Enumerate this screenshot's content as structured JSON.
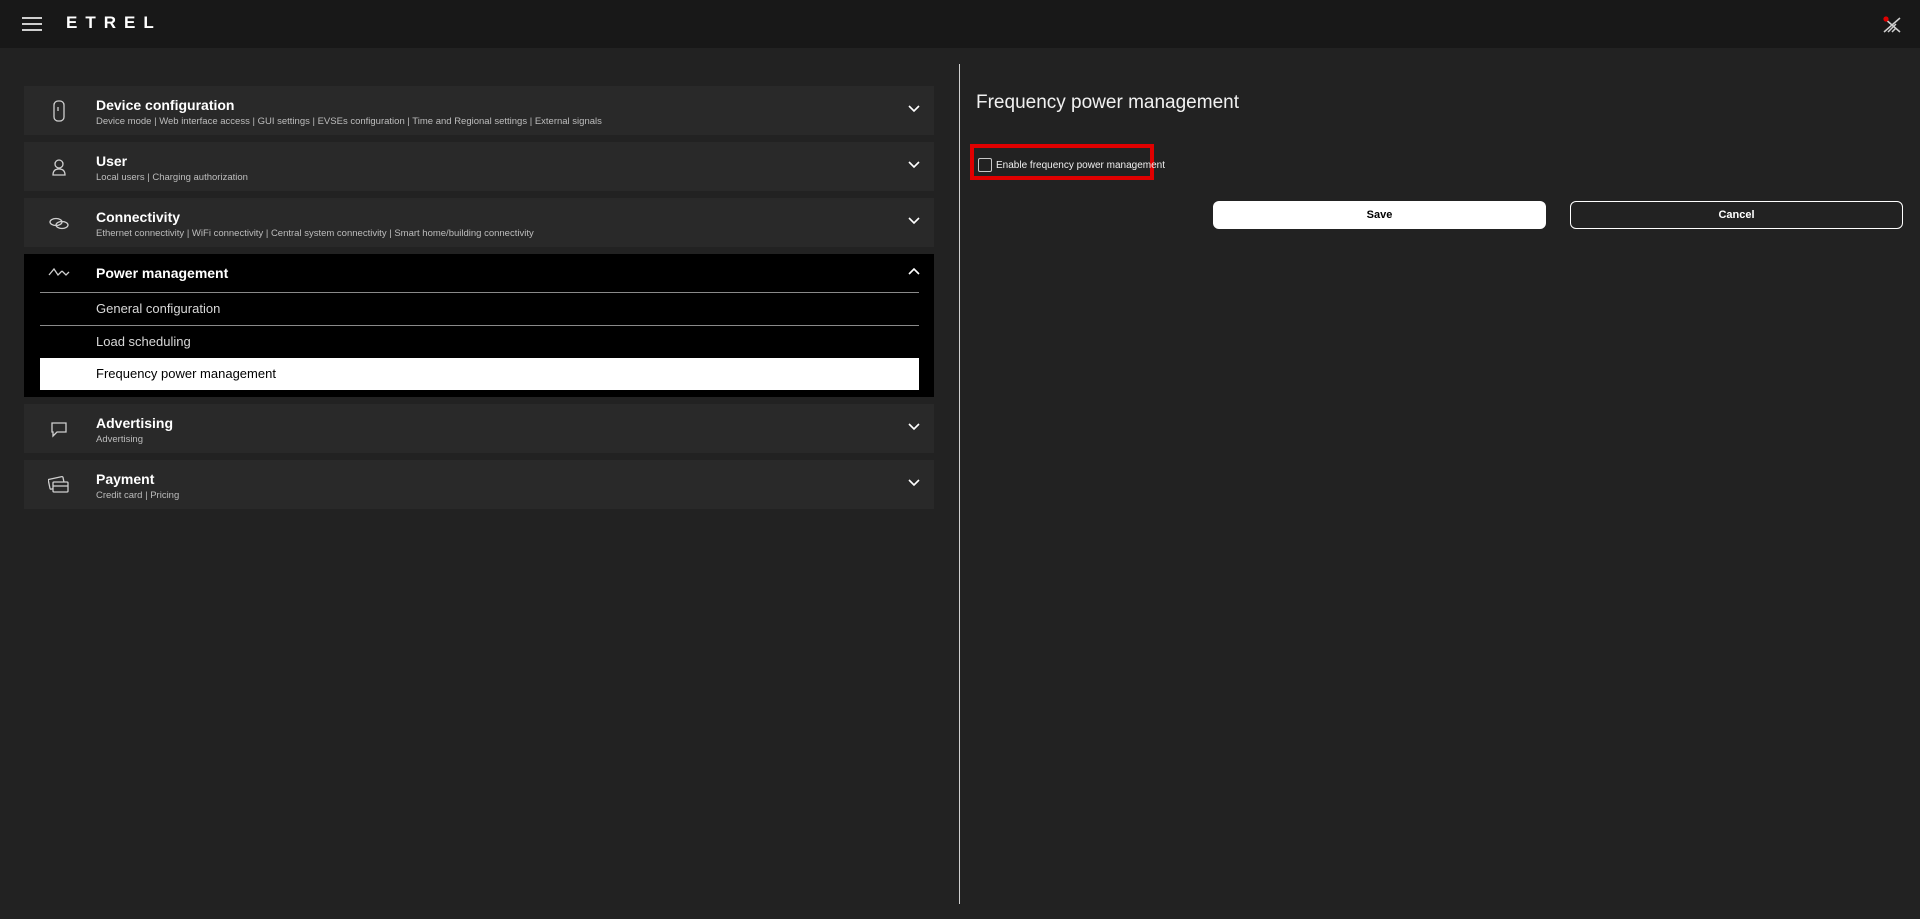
{
  "app": {
    "logo": "ETREL"
  },
  "header": {
    "menu_icon": "hamburger-menu-icon",
    "status_icon": "network-disconnected-icon"
  },
  "sections": [
    {
      "title": "Device configuration",
      "subtitle": "Device mode  |  Web interface access  |  GUI settings  |  EVSEs configuration  |  Time and Regional settings  |  External signals",
      "icon": "device-icon"
    },
    {
      "title": "User",
      "subtitle": "Local users  |  Charging authorization",
      "icon": "user-icon"
    },
    {
      "title": "Connectivity",
      "subtitle": "Ethernet connectivity  |  WiFi connectivity  |  Central system connectivity  |  Smart home/building connectivity",
      "icon": "link-icon"
    },
    {
      "title": "Power management",
      "icon": "power-wave-icon",
      "expanded": true,
      "items": [
        "General configuration",
        "Load scheduling",
        "Frequency power management"
      ],
      "active_item": "Frequency power management"
    },
    {
      "title": "Advertising",
      "subtitle": "Advertising",
      "icon": "chat-icon"
    },
    {
      "title": "Payment",
      "subtitle": "Credit card  |  Pricing",
      "icon": "payment-card-icon"
    }
  ],
  "detail": {
    "title": "Frequency power management",
    "checkbox_label": "Enable frequency power management",
    "checkbox_checked": false,
    "save_label": "Save",
    "cancel_label": "Cancel"
  },
  "colors": {
    "background": "#222222",
    "topbar": "#181818",
    "highlight": "#e00000",
    "active_item": "#ffffff"
  }
}
